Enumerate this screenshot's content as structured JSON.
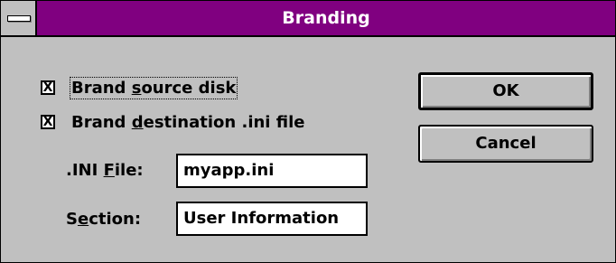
{
  "window": {
    "title": "Branding"
  },
  "checkboxes": [
    {
      "label_pre": "Brand ",
      "label_u": "s",
      "label_post": "ource disk",
      "checked": true,
      "mark": "X"
    },
    {
      "label_pre": "Brand ",
      "label_u": "d",
      "label_post": "estination .ini file",
      "checked": true,
      "mark": "X"
    }
  ],
  "fields": {
    "ini_file": {
      "label_pre": ".INI ",
      "label_u": "F",
      "label_post": "ile:",
      "value": "myapp.ini"
    },
    "section": {
      "label_pre": "S",
      "label_u": "e",
      "label_post": "ction:",
      "value": "User Information"
    }
  },
  "buttons": {
    "ok": "OK",
    "cancel": "Cancel"
  },
  "colors": {
    "titlebar": "#800080",
    "face": "#c0c0c0"
  },
  "icons": {
    "system_menu": "system-menu-icon"
  }
}
